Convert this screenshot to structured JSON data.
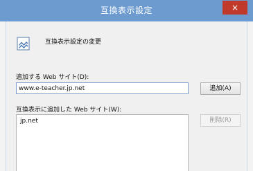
{
  "window": {
    "title": "互換表示設定",
    "close_label": "×",
    "titlebar_color": "#6d9bcf",
    "close_color": "#c0392b"
  },
  "header": {
    "icon": "compatibility-view-icon",
    "text": "互換表示設定の変更"
  },
  "add_section": {
    "label": "追加する Web サイト(D):",
    "input_value": "www.e-teacher.jp.net",
    "add_button": "追加(A)"
  },
  "list_section": {
    "label": "互換表示に追加した Web サイト(W):",
    "items": [
      "jp.net"
    ],
    "remove_button": "削除(R)"
  }
}
